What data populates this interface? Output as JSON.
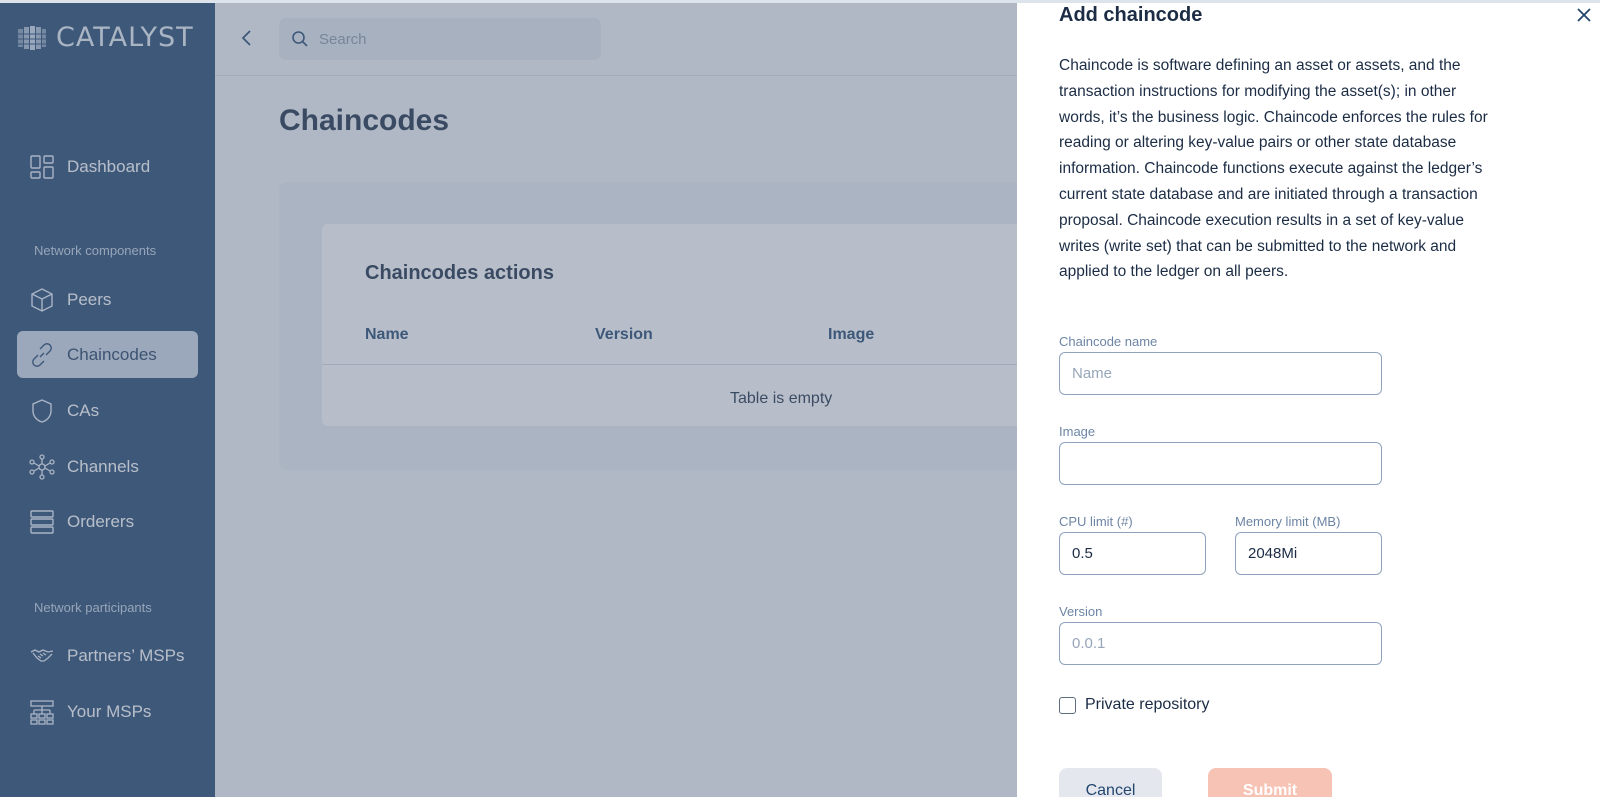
{
  "app": {
    "logo_text": "CATALYST"
  },
  "sidebar": {
    "items": [
      {
        "label": "Dashboard",
        "icon": "dashboard-icon"
      },
      {
        "label": "Peers",
        "icon": "cube-icon"
      },
      {
        "label": "Chaincodes",
        "icon": "link-icon",
        "active": true
      },
      {
        "label": "CAs",
        "icon": "shield-icon"
      },
      {
        "label": "Channels",
        "icon": "network-icon"
      },
      {
        "label": "Orderers",
        "icon": "server-icon"
      },
      {
        "label": "Partners’ MSPs",
        "icon": "handshake-icon"
      },
      {
        "label": "Your MSPs",
        "icon": "hierarchy-icon"
      }
    ],
    "sections": {
      "network_components": "Network components",
      "network_participants": "Network participants"
    }
  },
  "header": {
    "search_placeholder": "Search"
  },
  "main": {
    "title": "Chaincodes",
    "card": {
      "title": "Chaincodes actions",
      "columns": [
        "Name",
        "Version",
        "Image"
      ],
      "empty_text": "Table is empty"
    }
  },
  "drawer": {
    "title": "Add chaincode",
    "description": "Chaincode is software defining an asset or assets, and the transaction instructions for modifying the asset(s); in other words, it’s the business logic. Chaincode enforces the rules for reading or altering key-value pairs or other state database information. Chaincode functions execute against the ledger’s current state database and are initiated through a transaction proposal. Chaincode execution results in a set of key-value writes (write set) that can be submitted to the network and applied to the ledger on all peers.",
    "fields": {
      "name_label": "Chaincode name",
      "name_placeholder": "Name",
      "image_label": "Image",
      "image_value": "",
      "cpu_label": "CPU limit (#)",
      "cpu_value": "0.5",
      "memory_label": "Memory limit (MB)",
      "memory_value": "2048Mi",
      "version_label": "Version",
      "version_placeholder": "0.0.1"
    },
    "private_repo_label": "Private repository",
    "cancel_label": "Cancel",
    "submit_label": "Submit"
  },
  "colors": {
    "sidebar_bg": "#23466f",
    "active_item_bg": "#cdd8e6",
    "submit_bg": "#f7c3b5"
  }
}
